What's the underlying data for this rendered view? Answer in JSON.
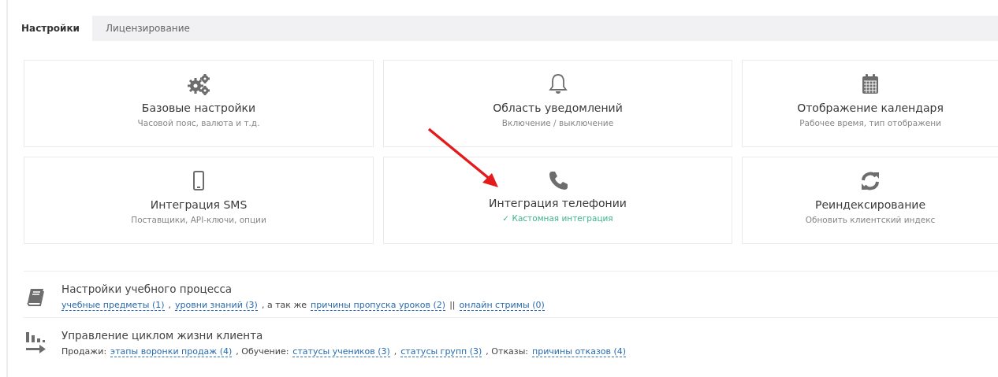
{
  "tabs": [
    {
      "label": "Настройки",
      "selected": true
    },
    {
      "label": "Лицензирование",
      "selected": false
    }
  ],
  "cards": [
    {
      "title": "Базовые настройки",
      "subtitle": {
        "text": "Часовой пояс, валюта и т.д.",
        "kind": "plain"
      }
    },
    {
      "title": "Область уведомлений",
      "subtitle": {
        "text": "Включение / выключение",
        "kind": "plain"
      }
    },
    {
      "title": "Отображение календаря",
      "subtitle": {
        "text": "Рабочее время, тип отображени",
        "kind": "plain"
      }
    },
    {
      "title": "Интеграция SMS",
      "subtitle": {
        "text": "Поставщики, API-ключи, опции",
        "kind": "plain"
      }
    },
    {
      "title": "Интеграция телефонии",
      "subtitle": {
        "text": "✓ Кастомная интеграция",
        "kind": "success"
      }
    },
    {
      "title": "Реиндексирование",
      "subtitle": {
        "text": "Обновить клиентский индекс",
        "kind": "plain"
      }
    }
  ],
  "annotation": {
    "kind": "arrow"
  },
  "sections": [
    {
      "title": "Настройки учебного процесса",
      "parts": [
        {
          "kind": "link",
          "text": "учебные предметы (1)"
        },
        {
          "kind": "text",
          "text": ","
        },
        {
          "kind": "link",
          "text": "уровни знаний (3)"
        },
        {
          "kind": "text",
          "text": ", а так же"
        },
        {
          "kind": "link",
          "text": "причины пропуска уроков (2)"
        },
        {
          "kind": "text",
          "text": "||"
        },
        {
          "kind": "link",
          "text": "онлайн стримы (0)"
        }
      ]
    },
    {
      "title": "Управление циклом жизни клиента",
      "parts": [
        {
          "kind": "text",
          "text": "Продажи:"
        },
        {
          "kind": "link",
          "text": "этапы воронки продаж (4)"
        },
        {
          "kind": "text",
          "text": ", Обучение:"
        },
        {
          "kind": "link",
          "text": "статусы учеников (3)"
        },
        {
          "kind": "text",
          "text": ","
        },
        {
          "kind": "link",
          "text": "статусы групп (3)"
        },
        {
          "kind": "text",
          "text": ", Отказы:"
        },
        {
          "kind": "link",
          "text": "причины отказов (4)"
        }
      ]
    }
  ]
}
